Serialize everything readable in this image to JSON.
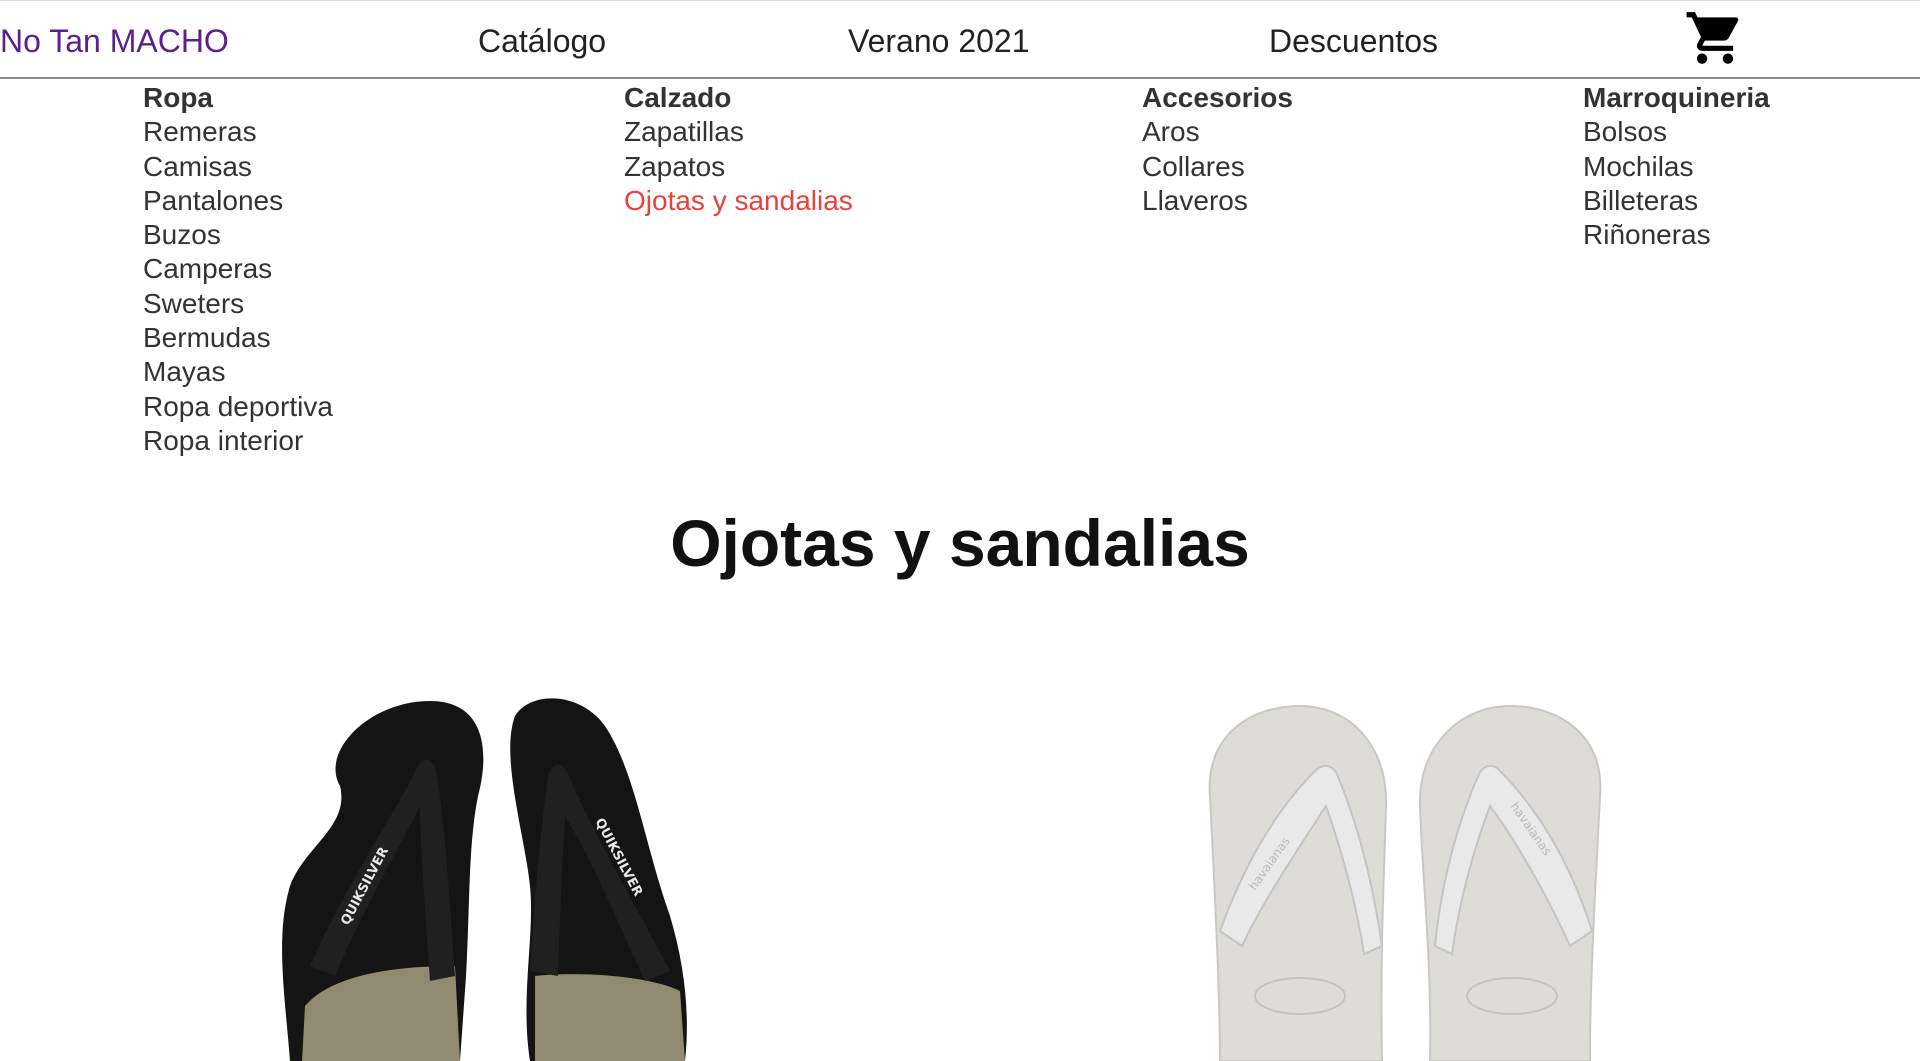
{
  "header": {
    "brand": "No Tan MACHO",
    "nav": [
      "Catálogo",
      "Verano 2021",
      "Descuentos"
    ],
    "cart_icon": "shopping-cart-icon",
    "brand_color": "#5b1f8e"
  },
  "menu": {
    "columns": [
      {
        "title": "Ropa",
        "items": [
          "Remeras",
          "Camisas",
          "Pantalones",
          "Buzos",
          "Camperas",
          "Sweters",
          "Bermudas",
          "Mayas",
          "Ropa deportiva",
          "Ropa interior"
        ]
      },
      {
        "title": "Calzado",
        "items": [
          "Zapatillas",
          "Zapatos",
          "Ojotas y sandalias"
        ]
      },
      {
        "title": "Accesorios",
        "items": [
          "Aros",
          "Collares",
          "Llaveros"
        ]
      },
      {
        "title": "Marroquineria",
        "items": [
          "Bolsos",
          "Mochilas",
          "Billeteras",
          "Riñoneras"
        ]
      }
    ],
    "active_item": "Ojotas y sandalias",
    "active_color": "#e8423a"
  },
  "main": {
    "title": "Ojotas y sandalias",
    "products": [
      {
        "image": "black-flip-flops-image",
        "strap_text": "QUIKSILVER"
      },
      {
        "image": "white-flip-flops-image",
        "strap_text": "havaianas"
      }
    ]
  }
}
